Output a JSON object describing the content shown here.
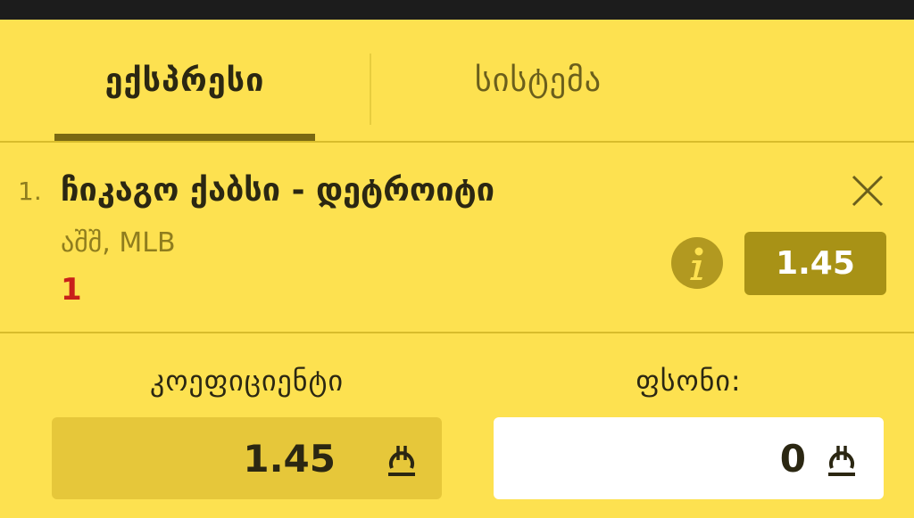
{
  "tabs": {
    "express_label": "ექსპრესი",
    "system_label": "სისტემა"
  },
  "bet": {
    "index": "1.",
    "title": "ჩიკაგო ქაბსი - დეტროიტი",
    "league": "აშშ, MLB",
    "outcome": "1",
    "odd": "1.45"
  },
  "summary": {
    "coefficient_label": "კოეფიციენტი",
    "coefficient_value": "1.45",
    "stake_label": "ფსონი:",
    "stake_value": "0"
  },
  "icons": {
    "close": "close-icon",
    "info": "info-icon",
    "currency": "lari-icon"
  },
  "colors": {
    "background": "#fde150",
    "accent_dark": "#7a6912",
    "odd_box": "#a89216",
    "outcome_red": "#c8201a"
  }
}
